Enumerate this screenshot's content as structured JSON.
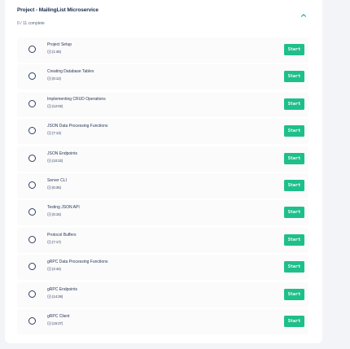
{
  "section": {
    "title": "Project - MailingList Microservice",
    "progress": "0 / 11 complete",
    "collapse_icon": "chevron-up-icon"
  },
  "colors": {
    "accent": "#1fbf8a",
    "title": "#1c2b4f",
    "background": "#f3f4f7"
  },
  "lessons": [
    {
      "title": "Project Setup",
      "duration": "(1:46)",
      "button": "Start"
    },
    {
      "title": "Creating Database Tables",
      "duration": "(6:12)",
      "button": "Start"
    },
    {
      "title": "Implementing CRUD Operations",
      "duration": "(12:02)",
      "button": "Start"
    },
    {
      "title": "JSON Data Processing Functions",
      "duration": "(7:13)",
      "button": "Start"
    },
    {
      "title": "JSON Endpoints",
      "duration": "(10:22)",
      "button": "Start"
    },
    {
      "title": "Server CLI",
      "duration": "(6:35)",
      "button": "Start"
    },
    {
      "title": "Testing JSON API",
      "duration": "(5:15)",
      "button": "Start"
    },
    {
      "title": "Protocol Buffers",
      "duration": "(7:17)",
      "button": "Start"
    },
    {
      "title": "gRPC Data Processing Functions",
      "duration": "(4:44)",
      "button": "Start"
    },
    {
      "title": "gRPC Endpoints",
      "duration": "(14:28)",
      "button": "Start"
    },
    {
      "title": "gRPC Client",
      "duration": "(15:27)",
      "button": "Start"
    }
  ]
}
